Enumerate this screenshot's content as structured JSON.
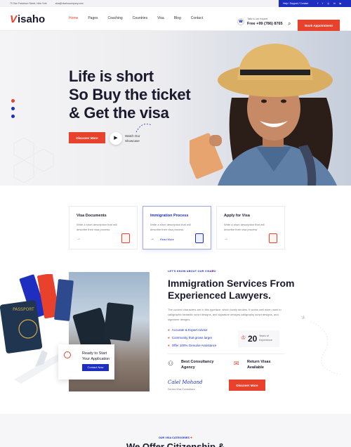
{
  "topbar": {
    "address": "70 San Francisco Street, New York",
    "email": "visa@visahocompany.com",
    "links": "Help / Support / Contact",
    "social": [
      "f",
      "t",
      "◎",
      "in",
      "▶"
    ]
  },
  "header": {
    "logo_mark": "V",
    "logo_rest": "isaho",
    "nav": [
      "Home",
      "Pages",
      "Coaching",
      "Countries",
      "Visa",
      "Blog",
      "Contact"
    ],
    "call_label": "Talk to an expert",
    "call_number": "Free +99 (786) 8765",
    "book_label": "Book Appointment"
  },
  "hero": {
    "line1": "Life is short",
    "line2": "So Buy the ticket",
    "line3": "& Get the visa",
    "discover_label": "Discover More",
    "watch_label": "Watch Our Showcase"
  },
  "cards": [
    {
      "title": "Visa Documents",
      "desc": "Write a short description that will describe their visa process"
    },
    {
      "title": "Immigration Process",
      "desc": "Write a short description that will describe their visa process",
      "read_more": "Read More"
    },
    {
      "title": "Apply for Visa",
      "desc": "Write a short description that will describe their visa process"
    }
  ],
  "about": {
    "ready_title": "Ready to Start Your Application",
    "contact_label": "Contact Now",
    "kicker": "LET'S KNOW ABOUT OUR VISAHO",
    "heading_1": "Immigration Services From",
    "heading_2": "Experienced Lawyers.",
    "paragraph": "The coolest characters are in this typeface, which lovely strokes. It works well when used in calligraphic fantastic script designs, and signature designs calligraphy script designs, and signature designs.",
    "checks": [
      "Accurate & Expert Advise",
      "Community that grows larger",
      "Offer 100% Genuine Assistance"
    ],
    "years_value": "20",
    "years_label": "Years of Experience",
    "feature_1": "Best Consultancy Agency",
    "feature_2": "Return Visas Available",
    "signature": "Calel Mohand",
    "signature_role": "Senior Visa Consultant",
    "more_label": "Discover More"
  },
  "categories": {
    "kicker": "OUR VISA CATEGORIES",
    "heading": "We Offer Citizenship &"
  },
  "colors": {
    "accent": "#e8412c",
    "primary": "#1e2fbf",
    "dark": "#1a1a2e"
  }
}
